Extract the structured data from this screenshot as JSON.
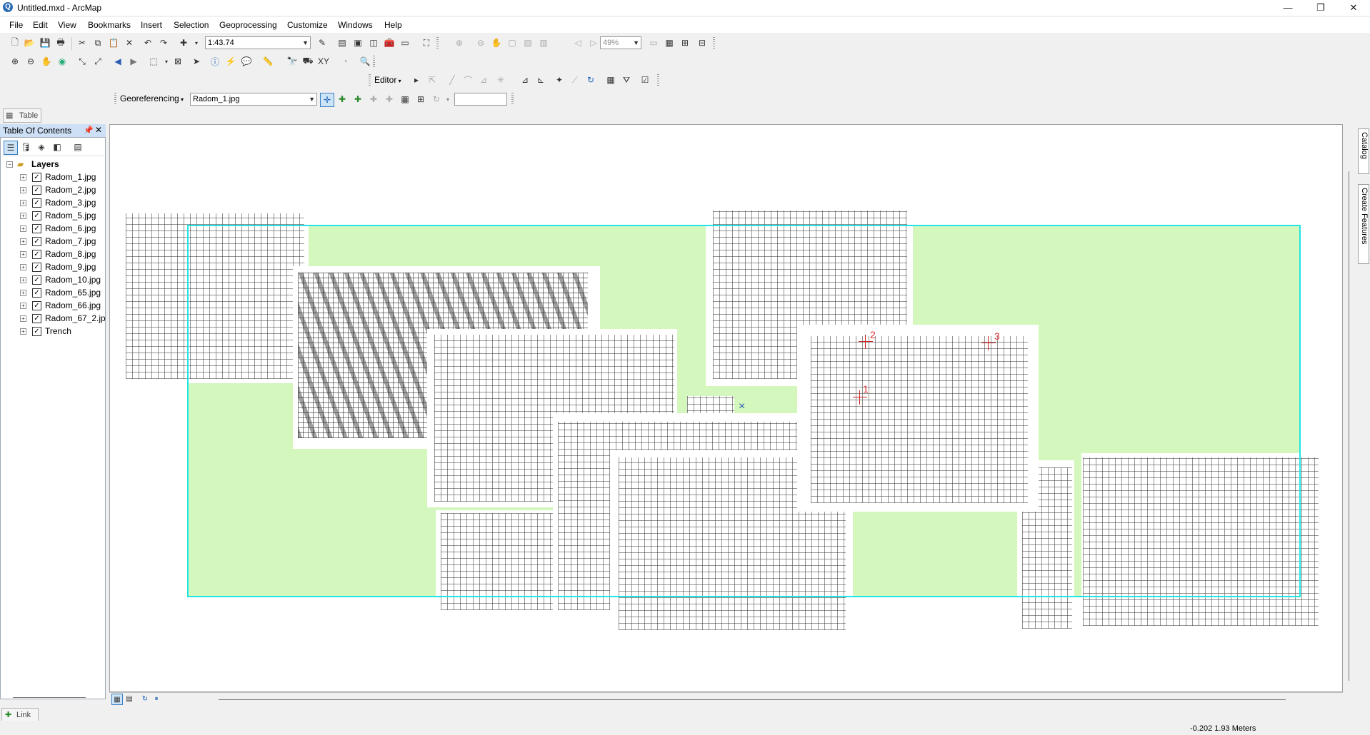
{
  "window": {
    "title": "Untitled.mxd - ArcMap",
    "minimize": "—",
    "restore": "❐",
    "close": "✕"
  },
  "menu": [
    "File",
    "Edit",
    "View",
    "Bookmarks",
    "Insert",
    "Selection",
    "Geoprocessing",
    "Customize",
    "Windows",
    "Help"
  ],
  "standard_toolbar": {
    "scale": "1:43.74",
    "zoom_percent": "49%"
  },
  "editor_toolbar": {
    "editor_label": "Editor"
  },
  "georef_toolbar": {
    "label": "Georeferencing",
    "layer": "Radom_1.jpg",
    "input_value": ""
  },
  "table_tab": "Table",
  "toc": {
    "title": "Table Of Contents",
    "root": "Layers",
    "layers": [
      "Radom_1.jpg",
      "Radom_2.jpg",
      "Radom_3.jpg",
      "Radom_5.jpg",
      "Radom_6.jpg",
      "Radom_7.jpg",
      "Radom_8.jpg",
      "Radom_9.jpg",
      "Radom_10.jpg",
      "Radom_65.jpg",
      "Radom_66.jpg",
      "Radom_67_2.jp",
      "Trench"
    ]
  },
  "map": {
    "control_points": [
      "1",
      "2",
      "3"
    ],
    "x_marker": "×",
    "colors": {
      "frame": "#22e6e6",
      "fill": "#d3f7bd",
      "control_point": "#e03030"
    }
  },
  "right_dock": {
    "catalog": "Catalog",
    "create_features": "Create Features"
  },
  "link_tab": "Link",
  "status": {
    "coordinates": "-0.202  1.93 Meters"
  }
}
